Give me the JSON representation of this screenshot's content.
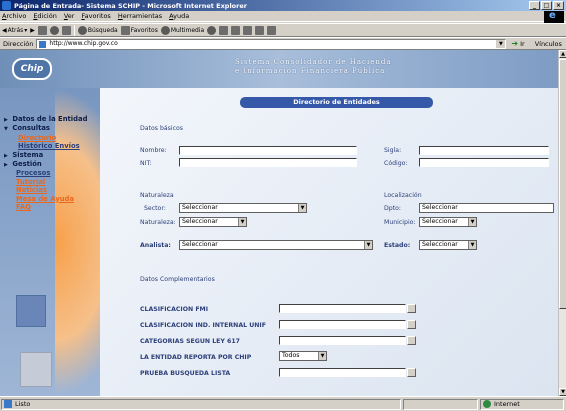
{
  "window": {
    "title": "Página de Entrada- Sistema SCHIP - Microsoft Internet Explorer"
  },
  "menu": [
    "Archivo",
    "Edición",
    "Ver",
    "Favoritos",
    "Herramientas",
    "Ayuda"
  ],
  "toolbar": {
    "back": "Atrás",
    "search": "Búsqueda",
    "favorites": "Favoritos",
    "multimedia": "Multimedia"
  },
  "address": {
    "label": "Dirección",
    "url": "http://www.chip.gov.co",
    "go": "Ir",
    "links": "Vínculos"
  },
  "banner": {
    "logo": "Chip",
    "title_line1": "Sistema Consolidador de Hacienda",
    "title_line2": "e Información Financiera Pública"
  },
  "nav": {
    "datos_entidad": "Datos de la Entidad",
    "consultas": "Consultas",
    "directorio": "Directorio",
    "historico": "Histórico Envíos",
    "sistema": "Sistema",
    "gestion": "Gestión",
    "procesos": "Procesos",
    "tutorial": "Tutorial",
    "noticias": "Noticias",
    "mesa_ayuda": "Mesa de Ayuda",
    "foro": "FAQ"
  },
  "form": {
    "header": "Directorio de Entidades",
    "datos_basicos": "Datos básicos",
    "nombre": "Nombre:",
    "nit": "NIT:",
    "sigla": "Sigla:",
    "codigo": "Código:",
    "naturaleza_section": "Naturaleza",
    "localizacion_section": "Localización",
    "sector": "Sector:",
    "sector_value": "Seleccionar",
    "naturaleza": "Naturaleza:",
    "naturaleza_value": "Seleccionar",
    "dpto": "Dpto:",
    "dpto_value": "Seleccionar",
    "municipio": "Municipio:",
    "municipio_value": "Seleccionar",
    "analista": "Analista:",
    "analista_value": "Seleccionar",
    "estado": "Estado:",
    "estado_value": "Seleccionar",
    "datos_complementarios": "Datos Complementarios",
    "clasificacion_fmi": "CLASIFICACION FMI",
    "clasificacion_ind": "CLASIFICACION IND. INTERNAL UNIF",
    "categorias": "CATEGORIAS SEGUN LEY 617",
    "entidad_reporta": "LA ENTIDAD REPORTA POR CHIP",
    "entidad_reporta_value": "Todos",
    "prueba": "PRUEBA BUSQUEDA LISTA"
  },
  "status": {
    "left": "Listo",
    "zone": "Internet"
  }
}
